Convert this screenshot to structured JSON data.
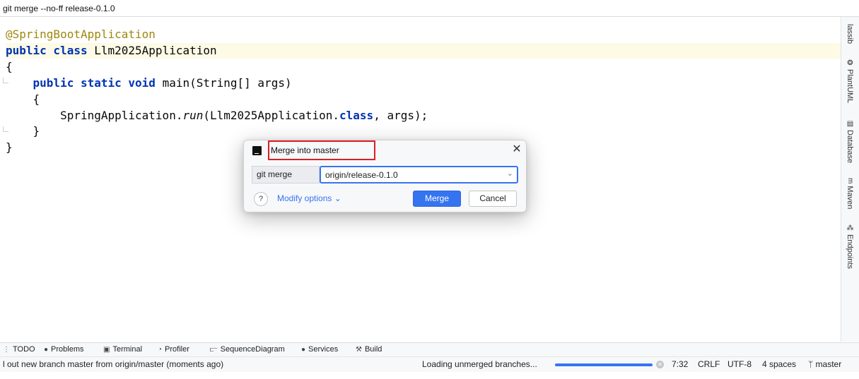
{
  "caption": "git merge --no-ff release-0.1.0",
  "editor": {
    "lines": [
      {
        "tokens": [
          {
            "t": "@SpringBootApplication",
            "c": "tok-annotation"
          }
        ]
      },
      {
        "tokens": [
          {
            "t": "public class ",
            "c": "tok-kw"
          },
          {
            "t": "Llm2025Application",
            "c": ""
          }
        ]
      },
      {
        "tokens": [
          {
            "t": "{",
            "c": ""
          }
        ]
      },
      {
        "tokens": [
          {
            "t": "    ",
            "c": ""
          },
          {
            "t": "public static void ",
            "c": "tok-kw"
          },
          {
            "t": "main(String[] args)",
            "c": ""
          }
        ]
      },
      {
        "tokens": [
          {
            "t": "    {",
            "c": ""
          }
        ]
      },
      {
        "tokens": [
          {
            "t": "        SpringApplication.",
            "c": ""
          },
          {
            "t": "run",
            "c": "tok-method"
          },
          {
            "t": "(Llm2025Application.",
            "c": ""
          },
          {
            "t": "class",
            "c": "tok-class"
          },
          {
            "t": ", args);",
            "c": ""
          }
        ]
      },
      {
        "tokens": [
          {
            "t": "    }",
            "c": ""
          }
        ]
      },
      {
        "tokens": [
          {
            "t": "}",
            "c": ""
          }
        ]
      }
    ]
  },
  "right_tabs": [
    {
      "label": "lassib",
      "icon": ""
    },
    {
      "label": "PlantUML",
      "icon": "❂"
    },
    {
      "label": "Database",
      "icon": "▤"
    },
    {
      "label": "Maven",
      "icon": "m"
    },
    {
      "label": "Endpoints",
      "icon": "⁂"
    }
  ],
  "tool_windows": [
    {
      "label": "TODO",
      "icon": "⋮"
    },
    {
      "label": "Problems",
      "icon": "●"
    },
    {
      "label": "Terminal",
      "icon": "▣"
    },
    {
      "label": "Profiler",
      "icon": "◔"
    },
    {
      "label": "SequenceDiagram",
      "icon": "⫍"
    },
    {
      "label": "Services",
      "icon": "●"
    },
    {
      "label": "Build",
      "icon": "⚒"
    }
  ],
  "status": {
    "message": "l out new branch master from origin/master (moments ago)",
    "task": "Loading unmerged branches...",
    "progress": 1.0,
    "position": "7:32",
    "line_separator": "CRLF",
    "encoding": "UTF-8",
    "indent": "4 spaces",
    "branch": "master",
    "branch_icon": "ᛘ"
  },
  "dialog": {
    "title": "Merge into master",
    "command_label": "git merge",
    "branch_value": "origin/release-0.1.0",
    "help_label": "?",
    "modify_options_label": "Modify options ⌄",
    "merge_label": "Merge",
    "cancel_label": "Cancel",
    "close_glyph": "✕",
    "chevron_glyph": "⌄"
  }
}
